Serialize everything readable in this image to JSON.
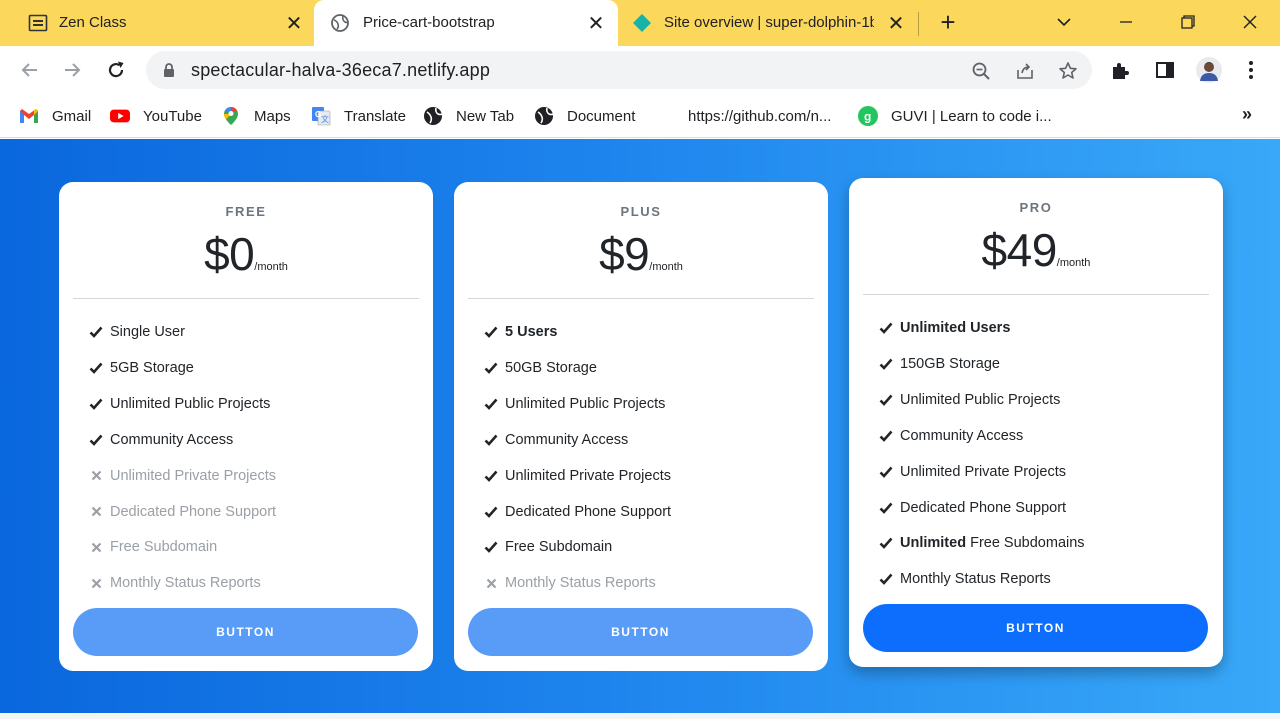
{
  "tabs": [
    {
      "title": "Zen Class",
      "active": false
    },
    {
      "title": "Price-cart-bootstrap",
      "active": true
    },
    {
      "title": "Site overview | super-dolphin-1b",
      "active": false
    }
  ],
  "omnibox": {
    "url": "spectacular-halva-36eca7.netlify.app"
  },
  "bookmarks": [
    {
      "label": "Gmail",
      "icon": "gmail-icon"
    },
    {
      "label": "YouTube",
      "icon": "youtube-icon"
    },
    {
      "label": "Maps",
      "icon": "maps-icon"
    },
    {
      "label": "Translate",
      "icon": "translate-icon"
    },
    {
      "label": "New Tab",
      "icon": "globe-icon"
    },
    {
      "label": "Document",
      "icon": "globe-icon"
    },
    {
      "label": "https://github.com/n...",
      "icon": ""
    },
    {
      "label": "GUVI | Learn to code i...",
      "icon": "guvi-icon"
    }
  ],
  "bookmarks_more": "»",
  "plans": [
    {
      "name": "FREE",
      "price": "$0",
      "period": "/month",
      "features": [
        {
          "pre": "",
          "bold": "",
          "text": "Single User",
          "included": true
        },
        {
          "pre": "",
          "bold": "",
          "text": "5GB Storage",
          "included": true
        },
        {
          "pre": "",
          "bold": "",
          "text": "Unlimited Public Projects",
          "included": true
        },
        {
          "pre": "",
          "bold": "",
          "text": "Community Access",
          "included": true
        },
        {
          "pre": "",
          "bold": "",
          "text": "Unlimited Private Projects",
          "included": false
        },
        {
          "pre": "",
          "bold": "",
          "text": "Dedicated Phone Support",
          "included": false
        },
        {
          "pre": "",
          "bold": "",
          "text": "Free Subdomain",
          "included": false
        },
        {
          "pre": "",
          "bold": "",
          "text": "Monthly Status Reports",
          "included": false
        }
      ],
      "button": "BUTTON"
    },
    {
      "name": "PLUS",
      "price": "$9",
      "period": "/month",
      "features": [
        {
          "pre": "",
          "bold": "5 Users",
          "text": "",
          "included": true
        },
        {
          "pre": "",
          "bold": "",
          "text": "50GB Storage",
          "included": true
        },
        {
          "pre": "",
          "bold": "",
          "text": "Unlimited Public Projects",
          "included": true
        },
        {
          "pre": "",
          "bold": "",
          "text": "Community Access",
          "included": true
        },
        {
          "pre": "",
          "bold": "",
          "text": "Unlimited Private Projects",
          "included": true
        },
        {
          "pre": "",
          "bold": "",
          "text": "Dedicated Phone Support",
          "included": true
        },
        {
          "pre": "",
          "bold": "",
          "text": "Free Subdomain",
          "included": true
        },
        {
          "pre": "",
          "bold": "",
          "text": "Monthly Status Reports",
          "included": false
        }
      ],
      "button": "BUTTON"
    },
    {
      "name": "PRO",
      "price": "$49",
      "period": "/month",
      "features": [
        {
          "pre": "",
          "bold": "Unlimited Users",
          "text": "",
          "included": true
        },
        {
          "pre": "",
          "bold": "",
          "text": "150GB Storage",
          "included": true
        },
        {
          "pre": "",
          "bold": "",
          "text": "Unlimited Public Projects",
          "included": true
        },
        {
          "pre": "",
          "bold": "",
          "text": "Community Access",
          "included": true
        },
        {
          "pre": "",
          "bold": "",
          "text": "Unlimited Private Projects",
          "included": true
        },
        {
          "pre": "",
          "bold": "",
          "text": "Dedicated Phone Support",
          "included": true
        },
        {
          "pre": "",
          "bold": "Unlimited",
          "text": " Free Subdomains",
          "included": true
        },
        {
          "pre": "",
          "bold": "",
          "text": "Monthly Status Reports",
          "included": true
        }
      ],
      "button": "BUTTON"
    }
  ],
  "colors": {
    "tabstrip": "#fbd75b",
    "page_gradient_start": "#0a67dd",
    "page_gradient_end": "#39a8f8",
    "button_light": "#599cf8",
    "button_primary": "#0d6efd",
    "excluded_feature": "#9aa0a6"
  }
}
